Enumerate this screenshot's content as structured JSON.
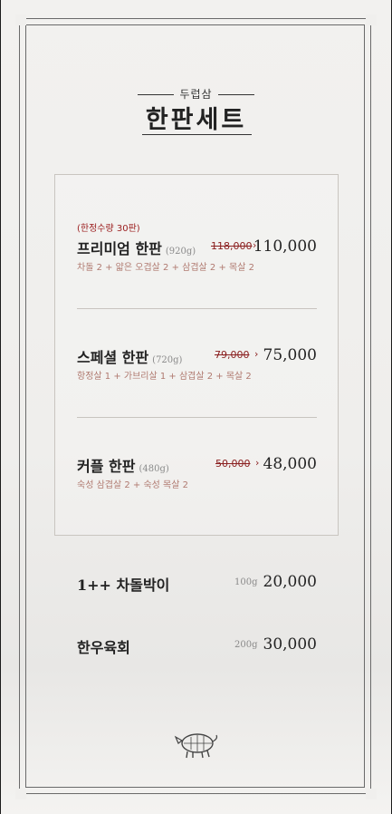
{
  "header": {
    "subtitle": "두럽삼",
    "title": "한판세트"
  },
  "sets": [
    {
      "badge": "(한정수량 30판)",
      "name": "프리미엄 한판",
      "weight": "(920g)",
      "old_price": "118,000",
      "arrow": "›",
      "price": "110,000",
      "description": "차돌 2 + 얇은 오겹살 2 + 삼겹살 2 + 목살 2"
    },
    {
      "name": "스페셜 한판",
      "weight": "(720g)",
      "old_price": "79,000",
      "arrow": "›",
      "price": "75,000",
      "description": "항정살 1 + 가브리살 1 + 삼겹살 2 + 목살 2"
    },
    {
      "name": "커플 한판",
      "weight": "(480g)",
      "old_price": "50,000",
      "arrow": "›",
      "price": "48,000",
      "description": "숙성 삼겹살 2 + 숙성 목살 2"
    }
  ],
  "extras": [
    {
      "name": "1++ 차돌박이",
      "weight": "100g",
      "price": "20,000"
    },
    {
      "name": "한우육회",
      "weight": "200g",
      "price": "30,000"
    }
  ],
  "logo_icon": "pig-logo-icon",
  "colors": {
    "accent_red": "#9a1c1c",
    "description_text": "#b07a70",
    "background": "#f2f1ef"
  }
}
